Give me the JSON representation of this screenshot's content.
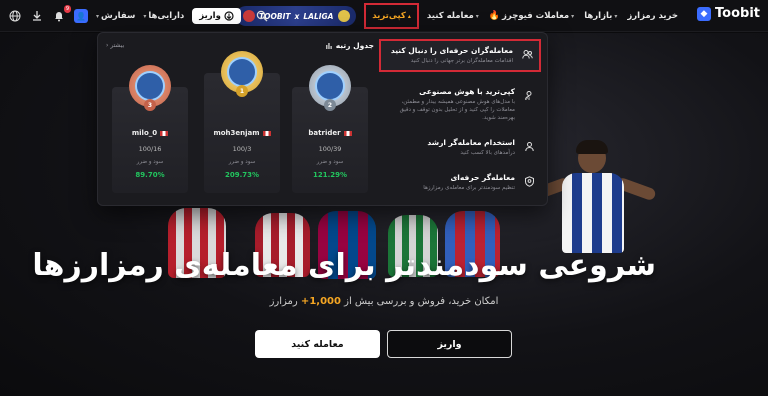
{
  "header": {
    "brand": "Toobit",
    "nav": [
      {
        "label": "خرید رمزارز"
      },
      {
        "label": "بازارها"
      },
      {
        "label": "معاملات فیوچرز"
      },
      {
        "label": "معامله کنید"
      },
      {
        "label": "کپی‌ترید"
      }
    ],
    "promo": {
      "left": "TOOBIT",
      "x": "x",
      "right": "LALIGA"
    },
    "search_icon": "search-icon",
    "deposit_label": "واریز",
    "assets_label": "دارایی‌ها",
    "orders_label": "سفارش",
    "notification_count": "9"
  },
  "copy_menu": {
    "items": [
      {
        "title": "معامله‌گران حرفه‌ای را دنبال کنید",
        "desc": "اقدامات معامله‌گران برتر جهانی را دنبال کنید",
        "icon": "users-icon"
      },
      {
        "title": "کپی‌ترید با هوش مصنوعی",
        "desc": "با مدل‌های هوش مصنوعی همیشه بیدار و مطمئن، معاملات را کپی کنید و از تحلیل بدون توقف و دقیق بهره‌مند شوید.",
        "icon": "ai-user-icon"
      },
      {
        "title": "استخدام معامله‌گر ارشد",
        "desc": "درآمدهای بالا کسب کنید",
        "icon": "user-icon"
      },
      {
        "title": "معامله‌گر حرفه‌ای",
        "desc": "تنظیم سودمندتر برای معامله‌ی رمزارزها",
        "icon": "shield-icon"
      }
    ]
  },
  "leaderboard": {
    "title": "جدول رتبه",
    "more": "بیشتر",
    "cards": [
      {
        "rank": "3",
        "name": "milo_0",
        "ratio": "100/16",
        "label": "سود و ضرر",
        "pct": "89.70%"
      },
      {
        "rank": "1",
        "name": "moh3enjam",
        "ratio": "100/3",
        "label": "سود و ضرر",
        "pct": "209.73%"
      },
      {
        "rank": "2",
        "name": "batrider",
        "ratio": "100/39",
        "label": "سود و ضرر",
        "pct": "121.29%"
      }
    ]
  },
  "hero": {
    "title": "شروعی سودمندتر برای معامله‌ی رمزارزها",
    "subtitle_pre": "امکان خرید، فروش و بررسی بیش از",
    "subtitle_num": "1,000+",
    "subtitle_post": "رمزارز",
    "trade_button": "معامله کنید",
    "deposit_button": "واریز"
  }
}
